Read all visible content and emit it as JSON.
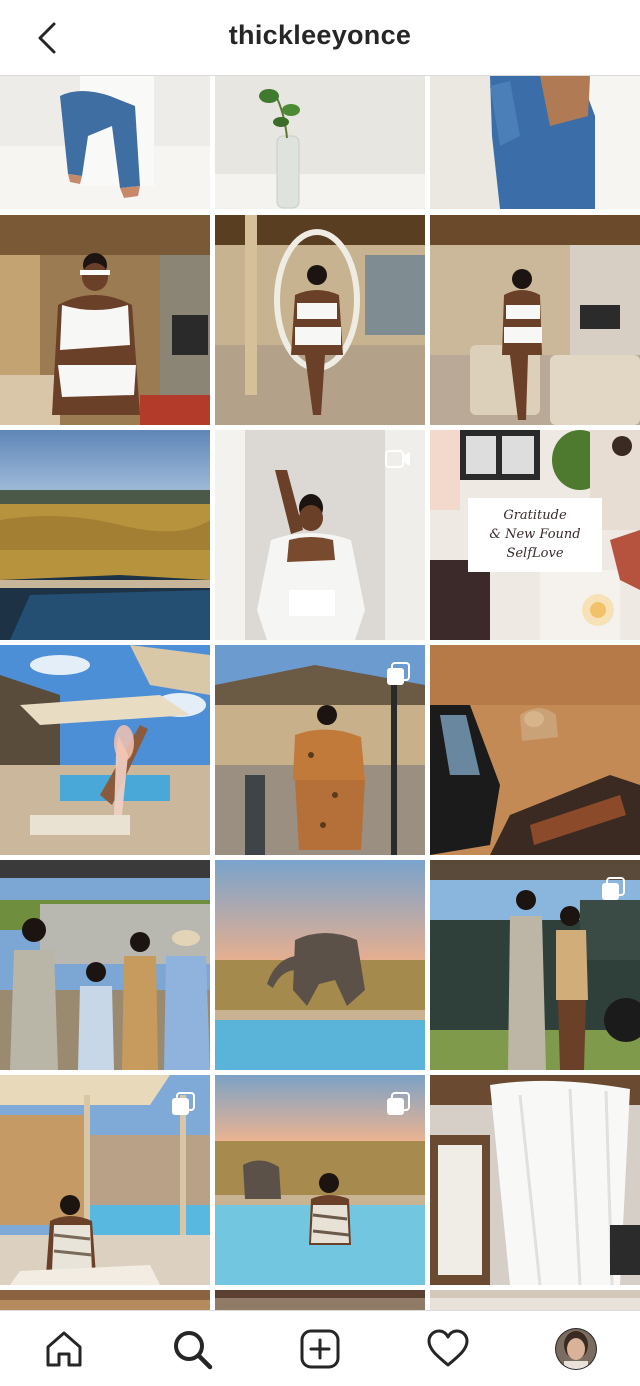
{
  "header": {
    "username": "thickleeyonce",
    "back_icon": "chevron-left-icon"
  },
  "grid": {
    "overlay_text": [
      "Gratitude",
      "& New Found",
      "SelfLove"
    ],
    "posts": [
      {
        "type": "photo",
        "scene": "woman in jeans on white cube"
      },
      {
        "type": "photo",
        "scene": "plant in glass vase"
      },
      {
        "type": "photo",
        "scene": "woman in denim jacket"
      },
      {
        "type": "photo",
        "scene": "woman in white swimsuit in lodge"
      },
      {
        "type": "photo",
        "scene": "woman in hanging egg chair"
      },
      {
        "type": "photo",
        "scene": "woman in white swimsuit on deck"
      },
      {
        "type": "photo",
        "scene": "savanna landscape with pool"
      },
      {
        "type": "video",
        "scene": "woman in white lingerie in doorway"
      },
      {
        "type": "photo",
        "scene": "collage gratitude"
      },
      {
        "type": "photo",
        "scene": "rose wine by pool"
      },
      {
        "type": "carousel",
        "scene": "woman in leopard print outfit"
      },
      {
        "type": "photo",
        "scene": "lioness from safari vehicle"
      },
      {
        "type": "photo",
        "scene": "group by safari vehicle"
      },
      {
        "type": "photo",
        "scene": "elephant drinking at pool"
      },
      {
        "type": "carousel",
        "scene": "two women by safari jeep"
      },
      {
        "type": "carousel",
        "scene": "woman on lounger by pool"
      },
      {
        "type": "carousel",
        "scene": "woman in infinity pool with elephant"
      },
      {
        "type": "photo",
        "scene": "bedroom with white canopy"
      }
    ]
  },
  "tab_bar": {
    "tabs": [
      "home-icon",
      "search-icon",
      "new-post-icon",
      "activity-heart-icon",
      "profile-avatar"
    ]
  },
  "colors": {
    "text": "#262626",
    "divider": "#dbdbdb",
    "background": "#ffffff"
  }
}
